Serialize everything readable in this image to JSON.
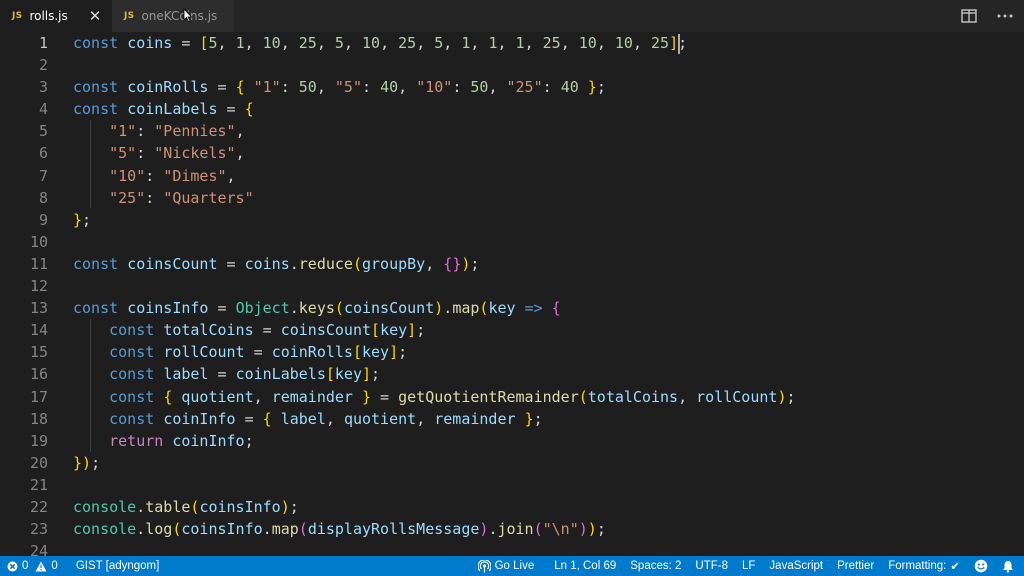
{
  "tabs": [
    {
      "label": "rolls.js",
      "filetype": "JS",
      "active": true
    },
    {
      "label": "oneKCoins.js",
      "filetype": "JS",
      "active": false
    }
  ],
  "tab_actions": [
    "split-editor-icon",
    "more-actions-icon"
  ],
  "editor": {
    "current_line": 1,
    "line_numbers": [
      "1",
      "2",
      "3",
      "4",
      "5",
      "6",
      "7",
      "8",
      "9",
      "10",
      "11",
      "12",
      "13",
      "14",
      "15",
      "16",
      "17",
      "18",
      "19",
      "20",
      "21",
      "22",
      "23",
      "24"
    ],
    "lines": [
      "const coins = [5, 1, 10, 25, 5, 10, 25, 5, 1, 1, 1, 25, 10, 10, 25];",
      "",
      "const coinRolls = { \"1\": 50, \"5\": 40, \"10\": 50, \"25\": 40 };",
      "const coinLabels = {",
      "    \"1\": \"Pennies\",",
      "    \"5\": \"Nickels\",",
      "    \"10\": \"Dimes\",",
      "    \"25\": \"Quarters\"",
      "};",
      "",
      "const coinsCount = coins.reduce(groupBy, {});",
      "",
      "const coinsInfo = Object.keys(coinsCount).map(key => {",
      "    const totalCoins = coinsCount[key];",
      "    const rollCount = coinRolls[key];",
      "    const label = coinLabels[key];",
      "    const { quotient, remainder } = getQuotientRemainder(totalCoins, rollCount);",
      "    const coinInfo = { label, quotient, remainder };",
      "    return coinInfo;",
      "});",
      "",
      "console.table(coinsInfo);",
      "console.log(coinsInfo.map(displayRollsMessage).join(\"\\n\"));",
      ""
    ]
  },
  "statusbar": {
    "errors": "0",
    "warnings": "0",
    "gist": "GIST [adyngom]",
    "go_live": "Go Live",
    "cursor": "Ln 1, Col 69",
    "spaces": "Spaces: 2",
    "encoding": "UTF-8",
    "eol": "LF",
    "language": "JavaScript",
    "prettier": "Prettier",
    "formatting": "Formatting:"
  },
  "colors": {
    "editor_bg": "#1e1e1e",
    "statusbar_bg": "#007acc",
    "keyword": "#569cd6",
    "variable": "#9cdcfe",
    "function": "#dcdcaa",
    "number": "#b5cea8",
    "string": "#ce9178",
    "class": "#4ec9b0"
  }
}
